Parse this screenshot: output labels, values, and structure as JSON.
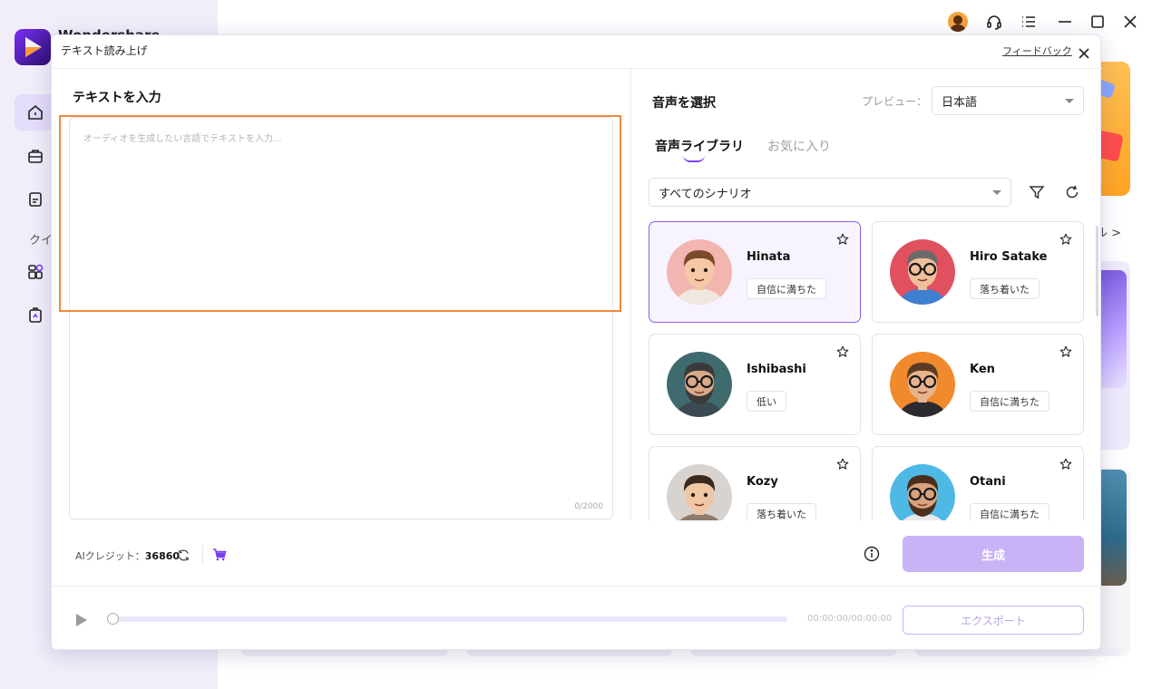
{
  "app": {
    "name": "Wondershare",
    "sidebar_section_label": "クイ",
    "bg_more_link": "ル >"
  },
  "modal": {
    "title": "テキスト読み上げ",
    "feedback_label": "フィードバック"
  },
  "text_input": {
    "heading": "テキストを入力",
    "placeholder": "オーディオを生成したい言語でテキストを入力...",
    "value": "",
    "char_count": "0/2000"
  },
  "voice_panel": {
    "heading": "音声を選択",
    "preview_label": "プレビュー：",
    "preview_language": "日本語",
    "tabs": [
      {
        "label": "音声ライブラリ",
        "active": true
      },
      {
        "label": "お気に入り",
        "active": false
      }
    ],
    "scenario_filter": "すべてのシナリオ",
    "voices": [
      {
        "name": "Hinata",
        "tag": "自信に満ちた",
        "selected": true,
        "avatar_bg": "#f3b5b0",
        "skin": "#f6c9a6",
        "hair": "#7a4a2a",
        "shirt": "#f0e8e0",
        "glasses": false,
        "beard": false
      },
      {
        "name": "Hiro Satake",
        "tag": "落ち着いた",
        "selected": false,
        "avatar_bg": "#e0505f",
        "skin": "#efc09c",
        "hair": "#6b6b6b",
        "shirt": "#3f7fd1",
        "glasses": true,
        "beard": false
      },
      {
        "name": "Ishibashi",
        "tag": "低い",
        "selected": false,
        "avatar_bg": "#3f6b6e",
        "skin": "#d9a98a",
        "hair": "#3a3a3a",
        "shirt": "#3b4a52",
        "glasses": true,
        "beard": true
      },
      {
        "name": "Ken",
        "tag": "自信に満ちた",
        "selected": false,
        "avatar_bg": "#f08a2c",
        "skin": "#e8b48e",
        "hair": "#5b3b24",
        "shirt": "#2b2b2f",
        "glasses": true,
        "beard": false
      },
      {
        "name": "Kozy",
        "tag": "落ち着いた",
        "selected": false,
        "avatar_bg": "#d9d3cf",
        "skin": "#f0c7a4",
        "hair": "#3a2a1e",
        "shirt": "#8c7b6f",
        "glasses": false,
        "beard": false
      },
      {
        "name": "Otani",
        "tag": "自信に満ちた",
        "selected": false,
        "avatar_bg": "#4fb9e6",
        "skin": "#d9a27c",
        "hair": "#4b2f1c",
        "shirt": "#e9e9ec",
        "glasses": true,
        "beard": true
      }
    ]
  },
  "footer": {
    "credit_label": "AIクレジット：",
    "credit_value": "36860",
    "generate_label": "生成",
    "time_readout": "00:00:00/00:00:00",
    "export_label": "エクスポート",
    "progress": 0
  },
  "colors": {
    "accent": "#7b3ff2",
    "generate_disabled": "#c9b3f7",
    "focus_outline": "#f08a3a"
  },
  "icons": [
    "user-avatar-icon",
    "headset-icon",
    "menu-list-icon",
    "minimize-icon",
    "maximize-icon",
    "close-icon",
    "home-icon",
    "toolbox-icon",
    "document-icon",
    "apps-icon",
    "clipboard-icon",
    "filter-icon",
    "refresh-icon",
    "star-icon",
    "info-icon",
    "cart-icon",
    "play-icon"
  ]
}
